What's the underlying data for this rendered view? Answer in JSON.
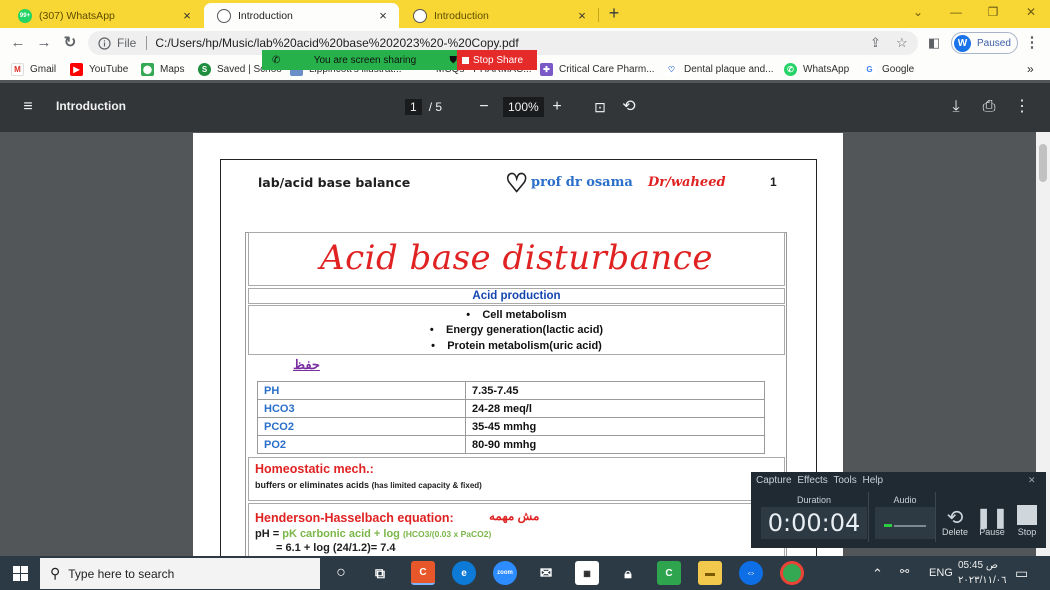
{
  "browser": {
    "tabs": [
      {
        "title": "(307) WhatsApp",
        "favicon": "whatsapp-icon",
        "badge": "99+"
      },
      {
        "title": "Introduction",
        "favicon": "globe-icon",
        "active": true
      },
      {
        "title": "Introduction",
        "favicon": "globe-icon"
      }
    ],
    "address": {
      "scheme": "File",
      "url": "C:/Users/hp/Music/lab%20acid%20base%202023%20-%20Copy.pdf"
    },
    "profile": {
      "initial": "W",
      "status": "Paused"
    },
    "bookmarks": [
      {
        "label": "Gmail",
        "icon": "gmail-icon"
      },
      {
        "label": "YouTube",
        "icon": "youtube-icon"
      },
      {
        "label": "Maps",
        "icon": "maps-pin-icon"
      },
      {
        "label": "Saved | Schoo",
        "icon": "saved-icon"
      },
      {
        "label": "Lippincott's illustrat...",
        "icon": "bookmark-icon"
      },
      {
        "label": "MCQs - PHARMAC...",
        "icon": "bookmark-icon"
      },
      {
        "label": "Critical Care Pharm...",
        "icon": "critical-care-icon"
      },
      {
        "label": "Dental plaque and...",
        "icon": "dental-icon"
      },
      {
        "label": "WhatsApp",
        "icon": "whatsapp-icon"
      },
      {
        "label": "Google",
        "icon": "google-icon"
      }
    ]
  },
  "screen_share": {
    "message": "You are screen sharing",
    "stop_label": "Stop Share"
  },
  "pdf": {
    "title": "Introduction",
    "page_current": "1",
    "page_total": "/ 5",
    "zoom": "100%"
  },
  "document": {
    "header_left": "lab/acid base balance",
    "header_author": "prof dr osama",
    "header_dr": "Dr/waheed",
    "header_page": "1",
    "main_title": "Acid base disturbance",
    "section_title": "Acid production",
    "bullets": [
      "Cell metabolism",
      "Energy generation(lactic acid)",
      "Protein metabolism(uric acid)"
    ],
    "arabic_note": "حفظ",
    "normal_values": [
      {
        "param": "PH",
        "value": "7.35-7.45"
      },
      {
        "param": "HCO3",
        "value": "24-28 meq/l"
      },
      {
        "param": "PCO2",
        "value": "35-45 mmhg"
      },
      {
        "param": "PO2",
        "value": "80-90 mmhg"
      }
    ],
    "homeostatic_heading": "Homeostatic mech.:",
    "homeostatic_text": "buffers or eliminates acids",
    "homeostatic_note": "(has limited capacity & fixed)",
    "hh_heading": "Henderson-Hasselbach equation:",
    "hh_arabic": "مش مهمه",
    "hh_prefix": "pH =",
    "hh_formula": "pK carbonic acid + log",
    "hh_small": "(HCO3/(0.03 x PaCO2)",
    "hh_result": "= 6.1 + log (24/1.2)= 7.4"
  },
  "recorder": {
    "menu": [
      "Capture",
      "Effects",
      "Tools",
      "Help"
    ],
    "duration_label": "Duration",
    "audio_label": "Audio",
    "timer": "0:00:04",
    "delete_label": "Delete",
    "pause_label": "Pause",
    "stop_label": "Stop"
  },
  "taskbar": {
    "search_placeholder": "Type here to search",
    "language": "ENG",
    "time": "05:45 ص",
    "date": "٢٠٢٣/١١/٠٦",
    "apps": [
      "task-view-icon",
      "camtasia-icon",
      "edge-icon",
      "zoom-icon",
      "mail-icon",
      "calendar-icon",
      "store-icon",
      "camtasia-green-icon",
      "file-explorer-icon",
      "teamviewer-icon",
      "chrome-icon"
    ]
  },
  "colors": {
    "tab_bar": "#f8d633",
    "title_red": "#e02222",
    "blue_link": "#2a6fc9",
    "green": "#7ab648",
    "share_green": "#27b14a",
    "share_red": "#e52a2a"
  }
}
